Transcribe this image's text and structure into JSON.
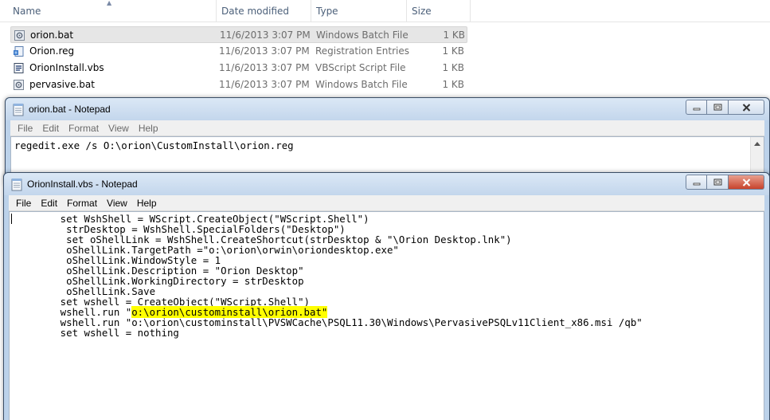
{
  "explorer": {
    "columns": [
      "Name",
      "Date modified",
      "Type",
      "Size"
    ],
    "files": [
      {
        "name": "orion.bat",
        "date": "11/6/2013 3:07 PM",
        "type": "Windows Batch File",
        "size": "1 KB",
        "icon": "batch-file-icon"
      },
      {
        "name": "Orion.reg",
        "date": "11/6/2013 3:07 PM",
        "type": "Registration Entries",
        "size": "1 KB",
        "icon": "registry-file-icon"
      },
      {
        "name": "OrionInstall.vbs",
        "date": "11/6/2013 3:07 PM",
        "type": "VBScript Script File",
        "size": "1 KB",
        "icon": "vbscript-file-icon"
      },
      {
        "name": "pervasive.bat",
        "date": "11/6/2013 3:07 PM",
        "type": "Windows Batch File",
        "size": "1 KB",
        "icon": "batch-file-icon"
      }
    ]
  },
  "notepad_back": {
    "title": "orion.bat - Notepad",
    "menu": [
      "File",
      "Edit",
      "Format",
      "View",
      "Help"
    ],
    "content": "regedit.exe /s O:\\orion\\CustomInstall\\orion.reg"
  },
  "notepad_front": {
    "title": "OrionInstall.vbs - Notepad",
    "menu": [
      "File",
      "Edit",
      "Format",
      "View",
      "Help"
    ],
    "lines": {
      "l1": "        set WshShell = WScript.CreateObject(\"WScript.Shell\")",
      "l2": "         strDesktop = WshShell.SpecialFolders(\"Desktop\")",
      "l3": "         set oShellLink = WshShell.CreateShortcut(strDesktop & \"\\Orion Desktop.lnk\")",
      "l4": "         oShellLink.TargetPath =\"o:\\orion\\orwin\\oriondesktop.exe\"",
      "l5": "         oShellLink.WindowStyle = 1",
      "l6": "         oShellLink.Description = \"Orion Desktop\"",
      "l7": "         oShellLink.WorkingDirectory = strDesktop",
      "l8": "         oShellLink.Save",
      "l9": "        set wshell = CreateObject(\"WScript.Shell\")",
      "l10_prefix": "        wshell.run \"",
      "l10_highlight": "o:\\orion\\custominstall\\orion.bat\"",
      "l11": "        wshell.run \"o:\\orion\\custominstall\\PVSWCache\\PSQL11.30\\Windows\\PervasivePSQLv11Client_x86.msi /qb\"",
      "l12": "        set wshell = nothing"
    },
    "highlight_color": "#ffff00"
  },
  "colors": {
    "titlebar": "#c3d6ec",
    "header_text": "#4c607a",
    "meta_text": "#6d6d6d"
  }
}
